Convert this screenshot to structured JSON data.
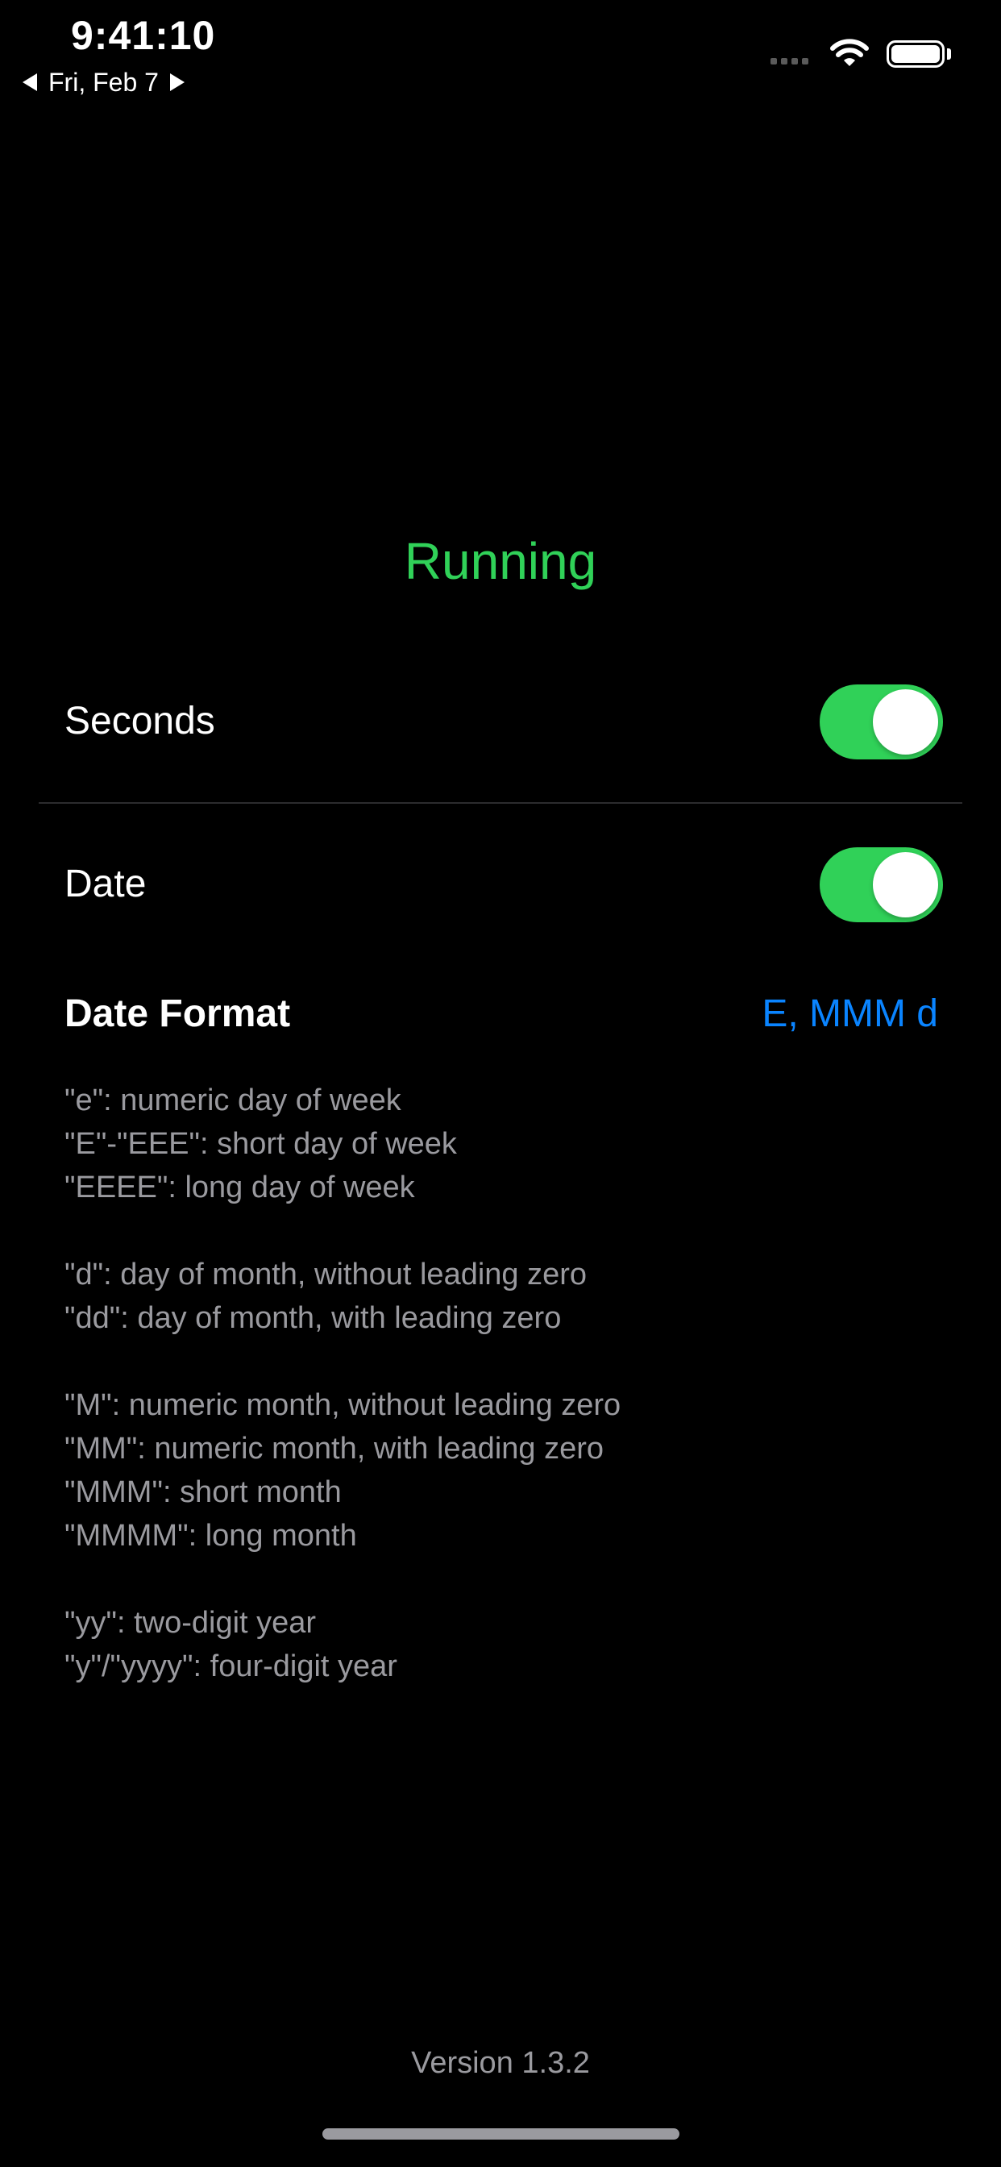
{
  "status_bar": {
    "time": "9:41:10",
    "date": "Fri, Feb 7",
    "battery_level": 1.0
  },
  "main": {
    "status": "Running",
    "status_color": "#30d158",
    "seconds": {
      "label": "Seconds",
      "enabled": true
    },
    "date": {
      "label": "Date",
      "enabled": true
    },
    "date_format": {
      "title": "Date Format",
      "value": "E, MMM d",
      "value_color": "#0a84ff"
    },
    "help_groups": [
      {
        "lines": [
          "\"e\": numeric day of week",
          "\"E\"-\"EEE\": short day of week",
          "\"EEEE\": long day of week"
        ]
      },
      {
        "lines": [
          "\"d\": day of month, without leading zero",
          "\"dd\": day of month, with leading zero"
        ]
      },
      {
        "lines": [
          "\"M\": numeric month, without leading zero",
          "\"MM\": numeric month, with leading zero",
          "\"MMM\": short month",
          "\"MMMM\": long month"
        ]
      },
      {
        "lines": [
          "\"yy\": two-digit year",
          "\"y\"/\"yyyy\": four-digit year"
        ]
      }
    ]
  },
  "footer": {
    "version": "Version 1.3.2"
  },
  "icons": [
    "previous-day-icon",
    "next-day-icon",
    "cellular-signal-icon",
    "wifi-icon",
    "battery-icon"
  ]
}
